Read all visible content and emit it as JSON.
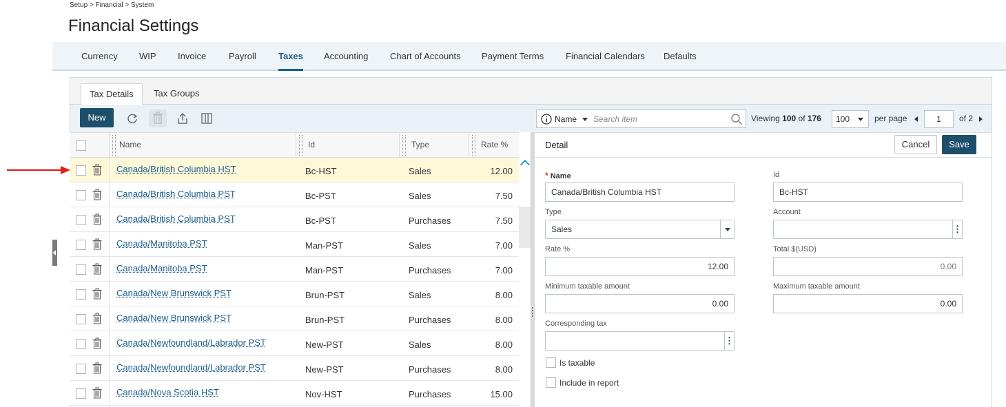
{
  "breadcrumb": "Setup > Financial > System",
  "page_title": "Financial Settings",
  "main_tabs": [
    {
      "label": "Currency",
      "active": false
    },
    {
      "label": "WIP",
      "active": false
    },
    {
      "label": "Invoice",
      "active": false
    },
    {
      "label": "Payroll",
      "active": false
    },
    {
      "label": "Taxes",
      "active": true
    },
    {
      "label": "Accounting",
      "active": false
    },
    {
      "label": "Chart of Accounts",
      "active": false
    },
    {
      "label": "Payment Terms",
      "active": false
    },
    {
      "label": "Financial Calendars",
      "active": false
    },
    {
      "label": "Defaults",
      "active": false
    }
  ],
  "sub_tabs": [
    {
      "label": "Tax Details",
      "active": true
    },
    {
      "label": "Tax Groups",
      "active": false
    }
  ],
  "toolbar": {
    "new_label": "New",
    "icons": [
      "refresh-icon",
      "delete-icon",
      "export-icon",
      "columns-icon"
    ]
  },
  "search": {
    "field": "Name",
    "placeholder": "Search item"
  },
  "paging": {
    "viewing_label": "Viewing",
    "viewing_count": "100",
    "of_label": "of",
    "total": "176",
    "per_page_value": "100",
    "per_page_label": "per page",
    "page": "1",
    "page_total_label": "of 2"
  },
  "grid": {
    "columns": [
      "Name",
      "Id",
      "Type",
      "Rate %"
    ],
    "rows": [
      {
        "name": "Canada/British Columbia HST",
        "id": "Bc-HST",
        "type": "Sales",
        "rate": "12.00",
        "selected": true
      },
      {
        "name": "Canada/British Columbia PST",
        "id": "Bc-PST",
        "type": "Sales",
        "rate": "7.50",
        "selected": false
      },
      {
        "name": "Canada/British Columbia PST",
        "id": "Bc-PST",
        "type": "Purchases",
        "rate": "7.50",
        "selected": false
      },
      {
        "name": "Canada/Manitoba PST",
        "id": "Man-PST",
        "type": "Sales",
        "rate": "7.00",
        "selected": false
      },
      {
        "name": "Canada/Manitoba PST",
        "id": "Man-PST",
        "type": "Purchases",
        "rate": "7.00",
        "selected": false
      },
      {
        "name": "Canada/New Brunswick PST",
        "id": "Brun-PST",
        "type": "Sales",
        "rate": "8.00",
        "selected": false
      },
      {
        "name": "Canada/New Brunswick PST",
        "id": "Brun-PST",
        "type": "Purchases",
        "rate": "8.00",
        "selected": false
      },
      {
        "name": "Canada/Newfoundland/Labrador PST",
        "id": "New-PST",
        "type": "Sales",
        "rate": "8.00",
        "selected": false
      },
      {
        "name": "Canada/Newfoundland/Labrador PST",
        "id": "New-PST",
        "type": "Purchases",
        "rate": "8.00",
        "selected": false
      },
      {
        "name": "Canada/Nova Scotia HST",
        "id": "Nov-HST",
        "type": "Purchases",
        "rate": "15.00",
        "selected": false
      }
    ]
  },
  "detail": {
    "title": "Detail",
    "cancel_label": "Cancel",
    "save_label": "Save",
    "name_required_mark": "*",
    "name_label": "Name",
    "name_value": "Canada/British Columbia HST",
    "id_label": "Id",
    "id_value": "Bc-HST",
    "type_label": "Type",
    "type_value": "Sales",
    "account_label": "Account",
    "account_value": "",
    "rate_label": "Rate %",
    "rate_value": "12.00",
    "total_label": "Total $(USD)",
    "total_value": "0.00",
    "min_label": "Minimum taxable amount",
    "min_value": "0.00",
    "max_label": "Maximum taxable amount",
    "max_value": "0.00",
    "corresponding_label": "Corresponding tax",
    "corresponding_value": "",
    "is_taxable_label": "Is taxable",
    "include_report_label": "Include in report"
  },
  "colors": {
    "accent": "#1c5d8c",
    "primary_button": "#1d4f6b",
    "selected_row": "#fcf8d8",
    "annotation_arrow": "#e0201c"
  }
}
